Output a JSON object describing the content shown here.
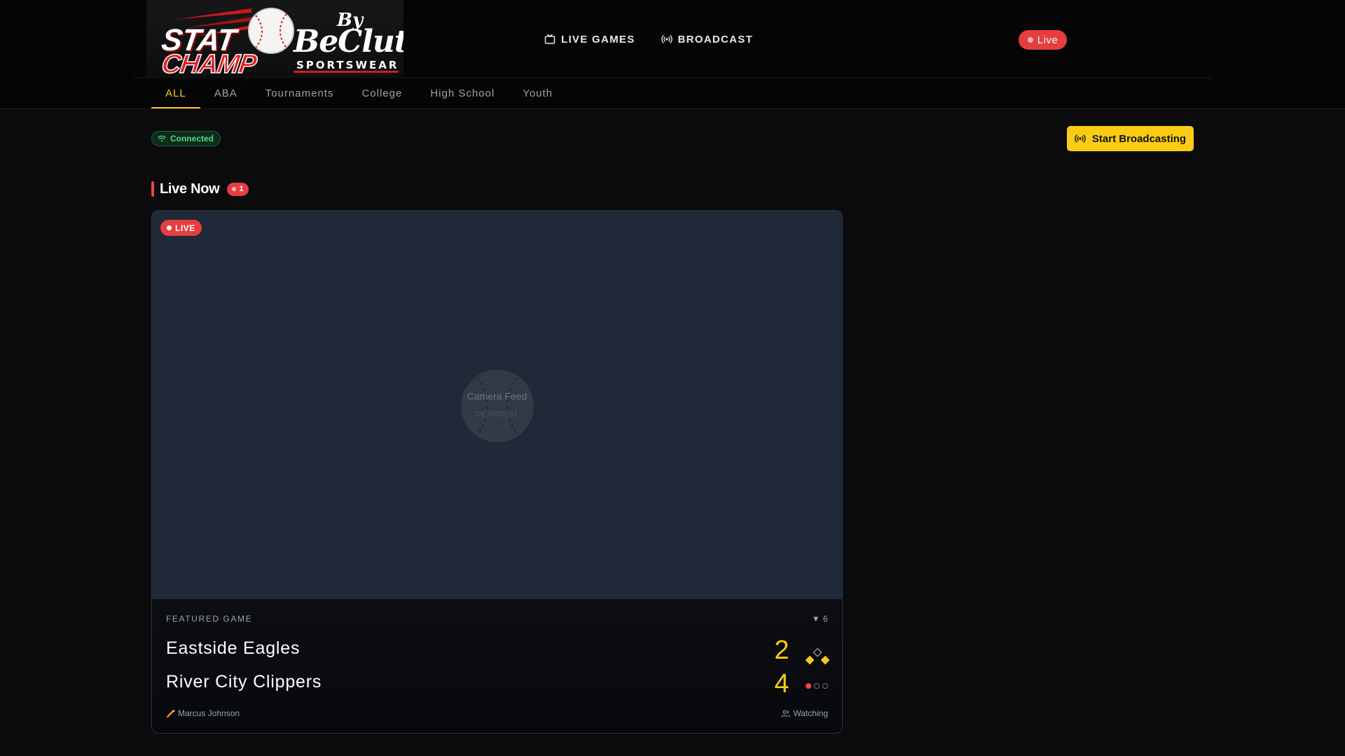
{
  "brand": {
    "stat_word": "STAT",
    "champ_word": "CHAMP",
    "by_word": "By",
    "beclutch_word": "BeClutch",
    "sportswear_word": "SPORTSWEAR"
  },
  "nav": {
    "live_games_label": "LIVE GAMES",
    "broadcast_label": "BROADCAST",
    "live_status_label": "Live"
  },
  "tabs": [
    {
      "label": "ALL",
      "active": true
    },
    {
      "label": "ABA",
      "active": false
    },
    {
      "label": "Tournaments",
      "active": false
    },
    {
      "label": "College",
      "active": false
    },
    {
      "label": "High School",
      "active": false
    },
    {
      "label": "Youth",
      "active": false
    }
  ],
  "status": {
    "connection_label": "Connected",
    "start_broadcasting_label": "Start Broadcasting"
  },
  "section": {
    "title": "Live Now",
    "count": "1"
  },
  "game": {
    "live_label": "LIVE",
    "feed_placeholder": "Camera Feed",
    "feed_id": "DEMO0001",
    "featured_label": "FEATURED GAME",
    "inning": "▼ 6",
    "home_team": "Eastside Eagles",
    "away_team": "River City Clippers",
    "home_score": "2",
    "away_score": "4",
    "bases": {
      "first": true,
      "second": false,
      "third": true
    },
    "outs": 1,
    "pitcher": "Marcus Johnson",
    "watching_label": "Watching"
  },
  "colors": {
    "accent": "#facc15",
    "live_red": "#e53e3e",
    "connected_green": "#4ade80",
    "background": "#0b0b0e",
    "card": "#1f2937"
  }
}
